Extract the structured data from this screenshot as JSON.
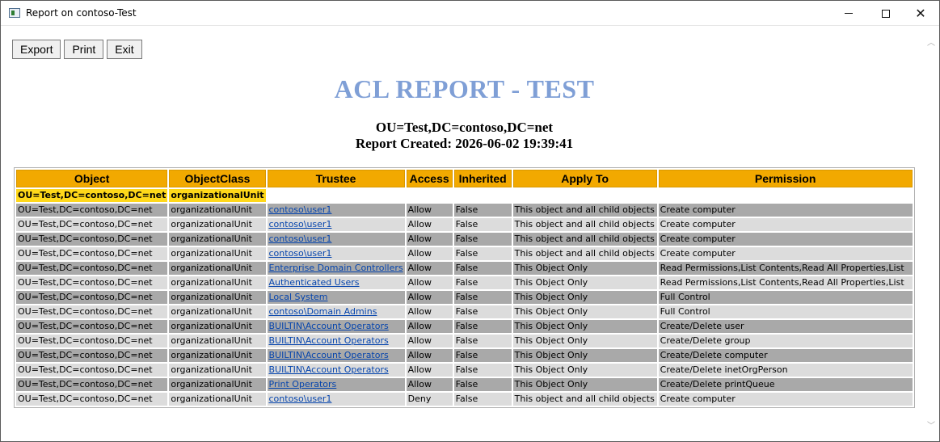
{
  "window": {
    "title": "Report on contoso-Test"
  },
  "toolbar": {
    "export_label": "Export",
    "print_label": "Print",
    "exit_label": "Exit"
  },
  "report": {
    "title": "ACL REPORT - TEST",
    "dn": "OU=Test,DC=contoso,DC=net",
    "created": "Report Created: 2026-06-02 19:39:41"
  },
  "table": {
    "headers": [
      "Object",
      "ObjectClass",
      "Trustee",
      "Access",
      "Inherited",
      "Apply To",
      "Permission"
    ],
    "object_header": {
      "object": "OU=Test,DC=contoso,DC=net",
      "objectclass": "organizationalUnit"
    },
    "rows": [
      [
        "OU=Test,DC=contoso,DC=net",
        "organizationalUnit",
        "contoso\\user1",
        "Allow",
        "False",
        "This object and all child objects",
        "Create computer"
      ],
      [
        "OU=Test,DC=contoso,DC=net",
        "organizationalUnit",
        "contoso\\user1",
        "Allow",
        "False",
        "This object and all child objects",
        "Create computer"
      ],
      [
        "OU=Test,DC=contoso,DC=net",
        "organizationalUnit",
        "contoso\\user1",
        "Allow",
        "False",
        "This object and all child objects",
        "Create computer"
      ],
      [
        "OU=Test,DC=contoso,DC=net",
        "organizationalUnit",
        "contoso\\user1",
        "Allow",
        "False",
        "This object and all child objects",
        "Create computer"
      ],
      [
        "OU=Test,DC=contoso,DC=net",
        "organizationalUnit",
        "Enterprise Domain Controllers",
        "Allow",
        "False",
        "This Object Only",
        "Read Permissions,List Contents,Read All Properties,List"
      ],
      [
        "OU=Test,DC=contoso,DC=net",
        "organizationalUnit",
        "Authenticated Users",
        "Allow",
        "False",
        "This Object Only",
        "Read Permissions,List Contents,Read All Properties,List"
      ],
      [
        "OU=Test,DC=contoso,DC=net",
        "organizationalUnit",
        "Local System",
        "Allow",
        "False",
        "This Object Only",
        "Full Control"
      ],
      [
        "OU=Test,DC=contoso,DC=net",
        "organizationalUnit",
        "contoso\\Domain Admins",
        "Allow",
        "False",
        "This Object Only",
        "Full Control"
      ],
      [
        "OU=Test,DC=contoso,DC=net",
        "organizationalUnit",
        "BUILTIN\\Account Operators",
        "Allow",
        "False",
        "This Object Only",
        "Create/Delete user"
      ],
      [
        "OU=Test,DC=contoso,DC=net",
        "organizationalUnit",
        "BUILTIN\\Account Operators",
        "Allow",
        "False",
        "This Object Only",
        "Create/Delete group"
      ],
      [
        "OU=Test,DC=contoso,DC=net",
        "organizationalUnit",
        "BUILTIN\\Account Operators",
        "Allow",
        "False",
        "This Object Only",
        "Create/Delete computer"
      ],
      [
        "OU=Test,DC=contoso,DC=net",
        "organizationalUnit",
        "BUILTIN\\Account Operators",
        "Allow",
        "False",
        "This Object Only",
        "Create/Delete inetOrgPerson"
      ],
      [
        "OU=Test,DC=contoso,DC=net",
        "organizationalUnit",
        "Print Operators",
        "Allow",
        "False",
        "This Object Only",
        "Create/Delete printQueue"
      ],
      [
        "OU=Test,DC=contoso,DC=net",
        "organizationalUnit",
        "contoso\\user1",
        "Deny",
        "False",
        "This object and all child objects",
        "Create computer"
      ]
    ]
  },
  "colors": {
    "title": "#7f9fd6",
    "header_bg": "#f2a900",
    "object_row_bg": "#ffd81a",
    "row_dark": "#a9a9a9",
    "row_light": "#dcdcdc",
    "link": "#0645ad"
  },
  "icons": {
    "app": "window-app-icon",
    "minimize": "minimize-icon",
    "maximize": "maximize-icon",
    "close": "close-icon"
  }
}
